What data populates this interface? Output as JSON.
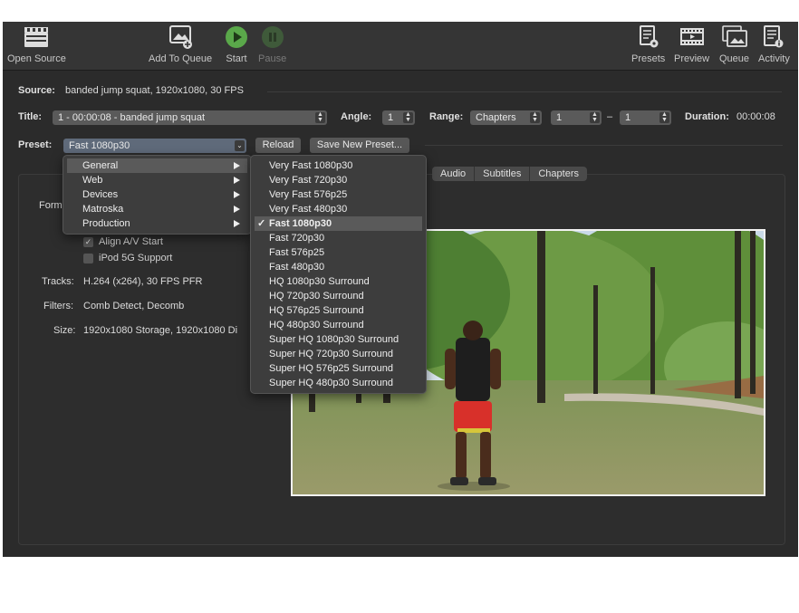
{
  "toolbar": {
    "open_source": "Open Source",
    "add_to_queue": "Add To Queue",
    "start": "Start",
    "pause": "Pause",
    "presets": "Presets",
    "preview": "Preview",
    "queue": "Queue",
    "activity": "Activity"
  },
  "source": {
    "label": "Source:",
    "value": "banded jump squat, 1920x1080, 30 FPS"
  },
  "title": {
    "label": "Title:",
    "value": "1 - 00:00:08 - banded jump squat"
  },
  "angle": {
    "label": "Angle:",
    "value": "1"
  },
  "range": {
    "label": "Range:",
    "mode": "Chapters",
    "start": "1",
    "dash": "–",
    "end": "1"
  },
  "duration": {
    "label": "Duration:",
    "value": "00:00:08"
  },
  "preset": {
    "label": "Preset:",
    "value": "Fast 1080p30",
    "reload": "Reload",
    "save_new": "Save New Preset..."
  },
  "tabs": [
    "Audio",
    "Subtitles",
    "Chapters"
  ],
  "summary": {
    "format_label_partial": "Form",
    "align_av": "Align A/V Start",
    "ipod": "iPod 5G Support",
    "tracks_label": "Tracks:",
    "tracks_value": "H.264 (x264), 30 FPS PFR",
    "filters_label": "Filters:",
    "filters_value": "Comb Detect, Decomb",
    "size_label": "Size:",
    "size_value": "1920x1080 Storage, 1920x1080 Di"
  },
  "category_menu": [
    "General",
    "Web",
    "Devices",
    "Matroska",
    "Production"
  ],
  "preset_menu": [
    "Very Fast 1080p30",
    "Very Fast 720p30",
    "Very Fast 576p25",
    "Very Fast 480p30",
    "Fast 1080p30",
    "Fast 720p30",
    "Fast 576p25",
    "Fast 480p30",
    "HQ 1080p30 Surround",
    "HQ 720p30 Surround",
    "HQ 576p25 Surround",
    "HQ 480p30 Surround",
    "Super HQ 1080p30 Surround",
    "Super HQ 720p30 Surround",
    "Super HQ 576p25 Surround",
    "Super HQ 480p30 Surround"
  ],
  "checkmark": "✓",
  "align_av_checked": true,
  "ipod_checked": false,
  "colors": {
    "start_green": "#5aa84a",
    "window_bg": "#2b2b2b",
    "menu_bg": "#3d3d3d"
  }
}
